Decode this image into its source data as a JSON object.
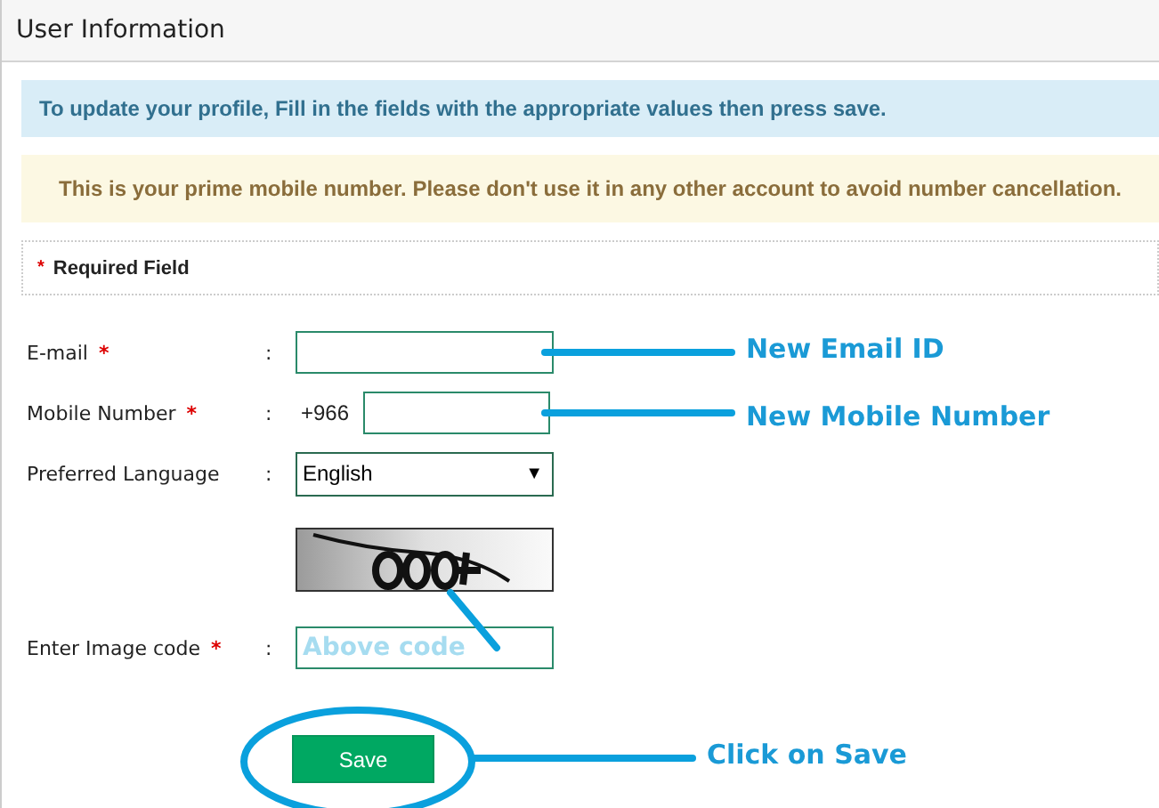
{
  "panel": {
    "title": "User Information"
  },
  "info_alert": "To update your profile, Fill in the fields with the appropriate values then press save.",
  "warning_alert": "This is your prime mobile number. Please don't use it in any other account to avoid number cancellation.",
  "required_note": {
    "mark": "*",
    "text": "Required Field"
  },
  "form": [
    {
      "kind": "text",
      "label": "E-mail",
      "required_mark": "*",
      "colon": ":"
    },
    {
      "kind": "phone",
      "label": "Mobile Number",
      "required_mark": "*",
      "colon": ":",
      "prefix": "+966"
    },
    {
      "kind": "select",
      "label": "Preferred Language",
      "colon": ":",
      "value": "English",
      "arrow": "▼"
    },
    {
      "kind": "captcha"
    },
    {
      "kind": "text",
      "label": "Enter Image code",
      "required_mark": "*",
      "colon": ":",
      "value": "Above code"
    }
  ],
  "save_button": "Save",
  "annotations": [
    {
      "kind": "line",
      "text": "New Email ID"
    },
    {
      "kind": "line",
      "text": "New Mobile Number"
    },
    {
      "kind": "field"
    },
    {
      "kind": "circle",
      "text": "Click on Save"
    }
  ]
}
